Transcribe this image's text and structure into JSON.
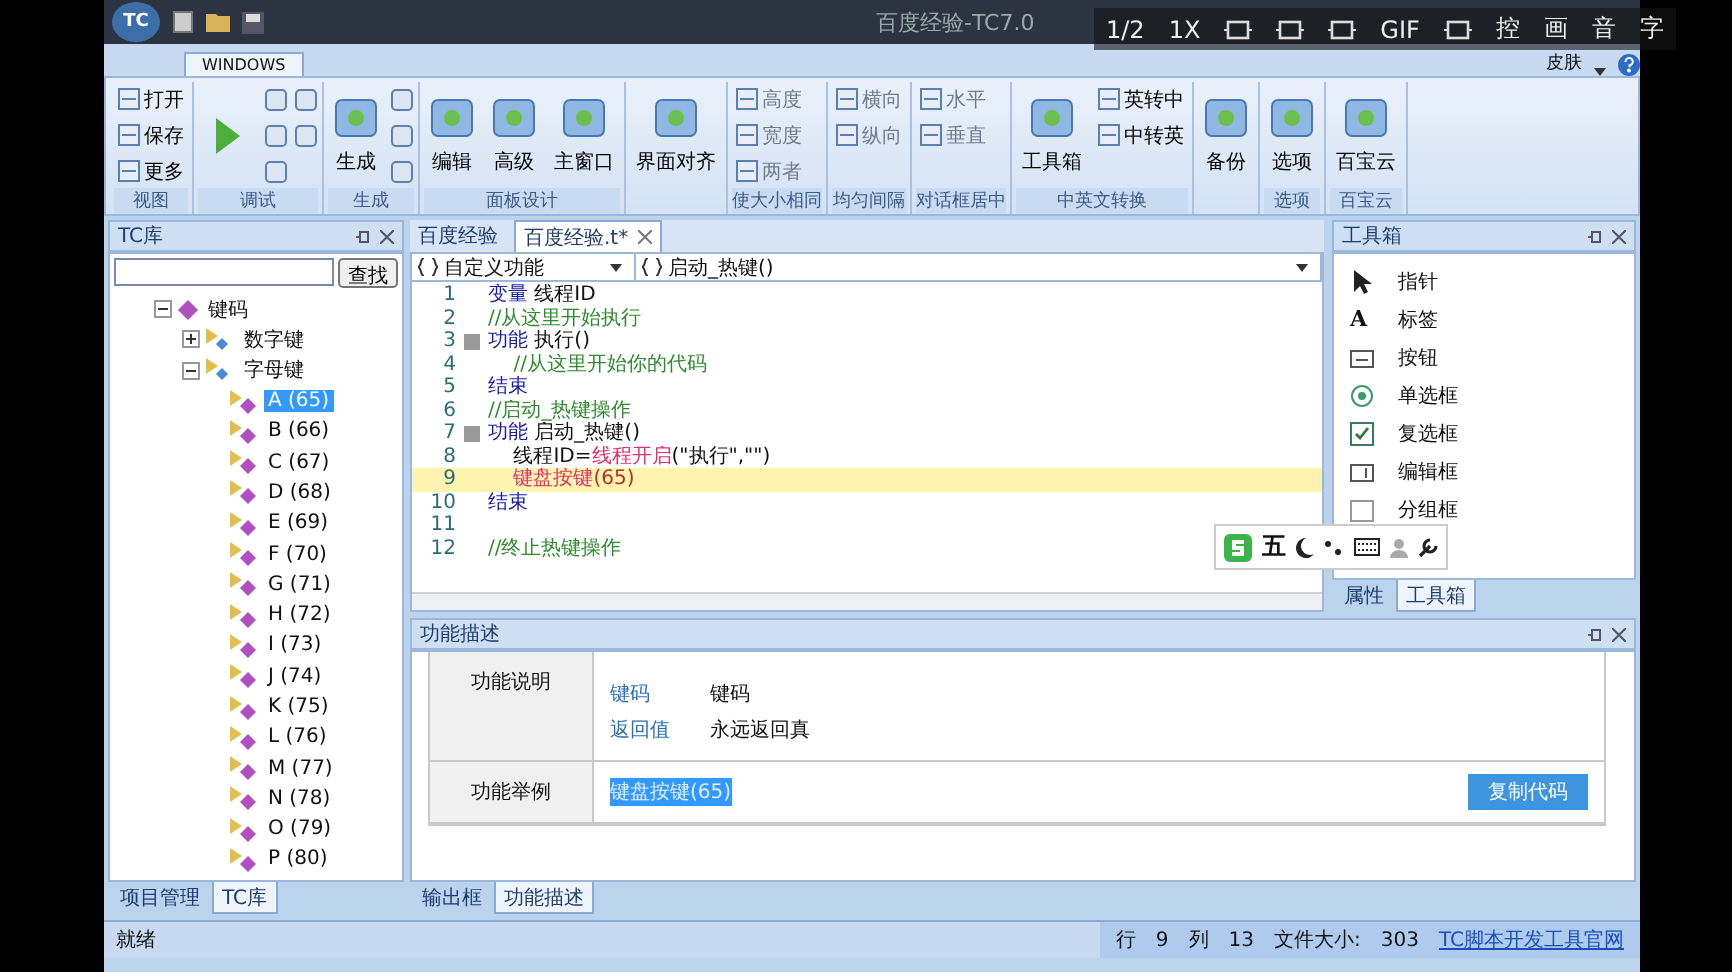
{
  "window": {
    "title": "百度经验-TC7.0",
    "logo": "TC"
  },
  "player_controls": [
    {
      "kind": "text",
      "label": "1/2"
    },
    {
      "kind": "text",
      "label": "1X"
    },
    {
      "kind": "icon"
    },
    {
      "kind": "icon"
    },
    {
      "kind": "icon"
    },
    {
      "kind": "text",
      "label": "GIF"
    },
    {
      "kind": "icon"
    },
    {
      "kind": "text",
      "label": "控"
    },
    {
      "kind": "text",
      "label": "画"
    },
    {
      "kind": "text",
      "label": "音"
    },
    {
      "kind": "text",
      "label": "字"
    }
  ],
  "ribbon": {
    "tab": "WINDOWS",
    "skin": "皮肤",
    "groups": [
      {
        "label": "视图",
        "buttons": [
          {
            "kind": "small",
            "label": "打开",
            "disabled": false
          },
          {
            "kind": "small",
            "label": "保存",
            "disabled": false
          },
          {
            "kind": "small",
            "label": "更多",
            "disabled": false
          }
        ]
      },
      {
        "label": "调试",
        "buttons": [
          {
            "kind": "run"
          },
          {
            "kind": "icon"
          },
          {
            "kind": "icon"
          },
          {
            "kind": "icon"
          },
          {
            "kind": "icon"
          },
          {
            "kind": "icon"
          }
        ]
      },
      {
        "label": "生成",
        "buttons": [
          {
            "kind": "big",
            "label": "生成",
            "disabled": false
          },
          {
            "kind": "icon"
          },
          {
            "kind": "icon"
          },
          {
            "kind": "icon"
          }
        ]
      },
      {
        "label": "面板设计",
        "buttons": [
          {
            "kind": "big",
            "label": "编辑",
            "disabled": false
          },
          {
            "kind": "big",
            "label": "高级",
            "disabled": false
          },
          {
            "kind": "big",
            "label": "主窗口",
            "disabled": false
          }
        ]
      },
      {
        "buttons": [
          {
            "kind": "big",
            "label": "界面对齐",
            "disabled": false
          }
        ]
      },
      {
        "label": "使大小相同",
        "buttons": [
          {
            "kind": "small",
            "label": "高度",
            "disabled": true
          },
          {
            "kind": "small",
            "label": "宽度",
            "disabled": true
          },
          {
            "kind": "small",
            "label": "两者",
            "disabled": true
          }
        ]
      },
      {
        "label": "均匀间隔",
        "buttons": [
          {
            "kind": "small",
            "label": "横向",
            "disabled": true
          },
          {
            "kind": "small",
            "label": "纵向",
            "disabled": true
          }
        ]
      },
      {
        "label": "对话框居中",
        "buttons": [
          {
            "kind": "small",
            "label": "水平",
            "disabled": true
          },
          {
            "kind": "small",
            "label": "垂直",
            "disabled": true
          }
        ]
      },
      {
        "label": "中英文转换",
        "buttons": [
          {
            "kind": "big",
            "label": "工具箱",
            "disabled": false
          },
          {
            "kind": "small",
            "label": "英转中",
            "disabled": false
          },
          {
            "kind": "small",
            "label": "中转英",
            "disabled": false
          }
        ]
      },
      {
        "buttons": [
          {
            "kind": "big",
            "label": "备份",
            "disabled": false
          }
        ]
      },
      {
        "label": "选项",
        "buttons": [
          {
            "kind": "big",
            "label": "选项",
            "disabled": false
          }
        ]
      },
      {
        "label": "百宝云",
        "buttons": [
          {
            "kind": "big",
            "label": "百宝云",
            "disabled": false
          }
        ]
      }
    ]
  },
  "library": {
    "title": "TC库",
    "search_button": "查找",
    "tree": [
      {
        "label": "键码",
        "expanded": true,
        "children": [
          {
            "label": "数字键",
            "expanded": false
          },
          {
            "label": "字母键",
            "expanded": true,
            "children": [
              {
                "label": "A (65)",
                "selected": true
              },
              {
                "label": "B (66)",
                "selected": false
              },
              {
                "label": "C (67)",
                "selected": false
              },
              {
                "label": "D (68)",
                "selected": false
              },
              {
                "label": "E (69)",
                "selected": false
              },
              {
                "label": "F (70)",
                "selected": false
              },
              {
                "label": "G (71)",
                "selected": false
              },
              {
                "label": "H (72)",
                "selected": false
              },
              {
                "label": "I (73)",
                "selected": false
              },
              {
                "label": "J (74)",
                "selected": false
              },
              {
                "label": "K (75)",
                "selected": false
              },
              {
                "label": "L (76)",
                "selected": false
              },
              {
                "label": "M (77)",
                "selected": false
              },
              {
                "label": "N (78)",
                "selected": false
              },
              {
                "label": "O (79)",
                "selected": false
              },
              {
                "label": "P (80)",
                "selected": false
              }
            ]
          }
        ]
      }
    ],
    "tabs": [
      {
        "label": "项目管理",
        "selected": false
      },
      {
        "label": "TC库",
        "selected": true
      }
    ]
  },
  "editor": {
    "tabs": [
      {
        "label": "百度经验",
        "selected": false
      },
      {
        "label": "百度经验.t*",
        "selected": true
      }
    ],
    "scope_dropdown": "自定义功能",
    "function_dropdown": "启动_热键()",
    "lines": [
      {
        "number": "1",
        "fold": false,
        "highlighted": false,
        "tokens": [
          {
            "kind": "keyword",
            "text": "变量"
          },
          {
            "kind": "text",
            "text": " 线程ID"
          }
        ]
      },
      {
        "number": "2",
        "fold": false,
        "highlighted": false,
        "tokens": [
          {
            "kind": "comment",
            "text": "//从这里开始执行"
          }
        ]
      },
      {
        "number": "3",
        "fold": true,
        "highlighted": false,
        "tokens": [
          {
            "kind": "keyword",
            "text": "功能"
          },
          {
            "kind": "text",
            "text": " 执行()"
          }
        ]
      },
      {
        "number": "4",
        "fold": false,
        "highlighted": false,
        "tokens": [
          {
            "kind": "comment",
            "text": "    //从这里开始你的代码"
          }
        ]
      },
      {
        "number": "5",
        "fold": false,
        "highlighted": false,
        "tokens": [
          {
            "kind": "keyword",
            "text": "结束"
          }
        ]
      },
      {
        "number": "6",
        "fold": false,
        "highlighted": false,
        "tokens": [
          {
            "kind": "comment",
            "text": "//启动_热键操作"
          }
        ]
      },
      {
        "number": "7",
        "fold": true,
        "highlighted": false,
        "tokens": [
          {
            "kind": "keyword",
            "text": "功能"
          },
          {
            "kind": "text",
            "text": " 启动_热键()"
          }
        ]
      },
      {
        "number": "8",
        "fold": false,
        "highlighted": false,
        "tokens": [
          {
            "kind": "text",
            "text": "    线程ID="
          },
          {
            "kind": "function",
            "text": "线程开启"
          },
          {
            "kind": "text",
            "text": "(\"执行\",\"\")"
          }
        ]
      },
      {
        "number": "9",
        "fold": false,
        "highlighted": true,
        "tokens": [
          {
            "kind": "function",
            "text": "    键盘按键"
          },
          {
            "kind": "number",
            "text": "(65)"
          }
        ]
      },
      {
        "number": "10",
        "fold": false,
        "highlighted": false,
        "tokens": [
          {
            "kind": "keyword",
            "text": "结束"
          }
        ]
      },
      {
        "number": "11",
        "fold": false,
        "highlighted": false
      },
      {
        "number": "12",
        "fold": false,
        "highlighted": false,
        "tokens": [
          {
            "kind": "comment",
            "text": "//终止热键操作"
          }
        ]
      }
    ]
  },
  "ime_bar": {
    "label": "五"
  },
  "toolbox": {
    "title": "工具箱",
    "items": [
      {
        "kind": "pointer",
        "label": "指针"
      },
      {
        "kind": "label",
        "glyph": "A",
        "label": "标签"
      },
      {
        "kind": "button",
        "label": "按钮"
      },
      {
        "kind": "radio",
        "label": "单选框"
      },
      {
        "kind": "checkbox",
        "label": "复选框"
      },
      {
        "kind": "edit",
        "label": "编辑框"
      },
      {
        "kind": "group",
        "label": "分组框"
      }
    ],
    "tabs": [
      {
        "label": "属性",
        "selected": false
      },
      {
        "label": "工具箱",
        "selected": true
      }
    ]
  },
  "description": {
    "title": "功能描述",
    "explain_label": "功能说明",
    "params": [
      {
        "name": "键码",
        "value": "键码"
      },
      {
        "name": "返回值",
        "value": "永远返回真"
      }
    ],
    "example_label": "功能举例",
    "example": "键盘按键(65)",
    "example_selected": true,
    "copy_button": "复制代码",
    "tabs": [
      {
        "label": "输出框",
        "selected": false
      },
      {
        "label": "功能描述",
        "selected": true
      }
    ]
  },
  "status_bar": {
    "text": "就绪",
    "row_label": "行",
    "row": "9",
    "col_label": "列",
    "col": "13",
    "size_label": "文件大小:",
    "size": "303",
    "link": "TC脚本开发工具官网"
  }
}
